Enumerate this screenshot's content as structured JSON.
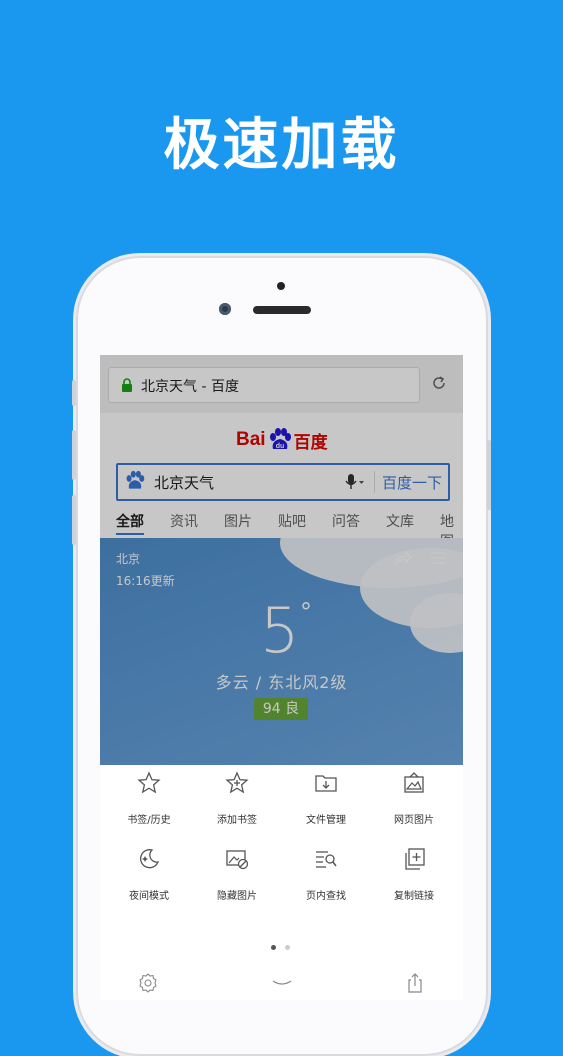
{
  "headline": "极速加载",
  "browser": {
    "url_title": "北京天气 - 百度",
    "logo": {
      "latin": "Bai",
      "paw_text": "du",
      "chinese": "百度"
    },
    "search": {
      "query": "北京天气",
      "button": "百度一下"
    },
    "tabs": [
      "全部",
      "资讯",
      "图片",
      "贴吧",
      "问答",
      "文库",
      "地图"
    ],
    "weather": {
      "city": "北京",
      "updated": "16:16更新",
      "temperature": "5",
      "degree": "°",
      "description": "多云 / 东北风2级",
      "aqi": "94 良"
    }
  },
  "menu": {
    "items": [
      {
        "label": "书签/历史",
        "icon": "star-icon"
      },
      {
        "label": "添加书签",
        "icon": "star-plus-icon"
      },
      {
        "label": "文件管理",
        "icon": "folder-download-icon"
      },
      {
        "label": "网页图片",
        "icon": "image-frame-icon"
      },
      {
        "label": "夜间模式",
        "icon": "moon-icon"
      },
      {
        "label": "隐藏图片",
        "icon": "hide-image-icon"
      },
      {
        "label": "页内查找",
        "icon": "find-in-page-icon"
      },
      {
        "label": "复制链接",
        "icon": "copy-link-icon"
      }
    ],
    "page_count": 2,
    "current_page": 1
  },
  "colors": {
    "background": "#1a97ef",
    "baidu_red": "#e10601",
    "baidu_blue": "#3c78d8",
    "aqi_green": "#6aaa3a"
  }
}
